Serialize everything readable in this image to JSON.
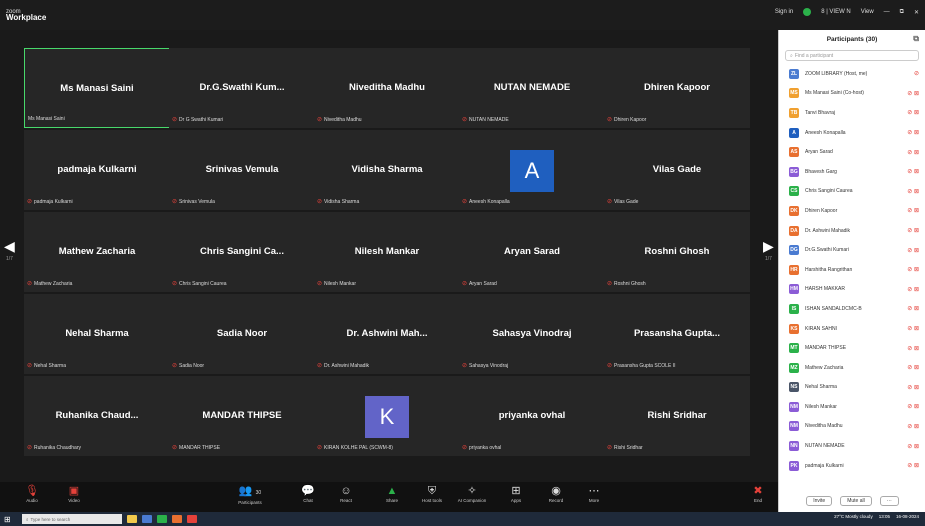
{
  "window": {
    "brand_small": "zoom",
    "app_name": "Workplace",
    "signin": "Sign in",
    "view_label": "View",
    "status_text": "8 | VIEW N"
  },
  "gallery": {
    "tiles": [
      {
        "name": "Ms Manasi Saini",
        "label": "Ms Manasi Saini"
      },
      {
        "name": "Dr.G.Swathi  Kum...",
        "label": "Dr G Swathi Kumari"
      },
      {
        "name": "Niveditha Madhu",
        "label": "Niveditha Madhu"
      },
      {
        "name": "NUTAN NEMADE",
        "label": "NUTAN NEMADE"
      },
      {
        "name": "Dhiren Kapoor",
        "label": "Dhiren Kapoor"
      },
      {
        "name": "padmaja Kulkarni",
        "label": "padmaja Kulkarni"
      },
      {
        "name": "Srinivas Vemula",
        "label": "Srinivas Vemula"
      },
      {
        "name": "Vidisha Sharma",
        "label": "Vidisha Sharma"
      },
      {
        "avatar_letter": "A",
        "label": "Aneesh Konapalla"
      },
      {
        "name": "Vilas Gade",
        "label": "Vilas Gade"
      },
      {
        "name": "Mathew Zacharia",
        "label": "Mathew Zacharia"
      },
      {
        "name": "Chris Sangini Ca...",
        "label": "Chris Sangini Caurea"
      },
      {
        "name": "Nilesh Mankar",
        "label": "Nilesh Mankar"
      },
      {
        "name": "Aryan Sarad",
        "label": "Aryan Sarad"
      },
      {
        "name": "Roshni Ghosh",
        "label": "Roshni Ghosh"
      },
      {
        "name": "Nehal Sharma",
        "label": "Nehal Sharma"
      },
      {
        "name": "Sadia Noor",
        "label": "Sadia Noor"
      },
      {
        "name": "Dr. Ashwini Mah...",
        "label": "Dr. Ashwini Mahadik"
      },
      {
        "name": "Sahasya Vinodraj",
        "label": "Sahasya Vinodraj"
      },
      {
        "name": "Prasansha Gupta...",
        "label": "Prasansha Gupta SCOLE II"
      },
      {
        "name": "Ruhanika  Chaud...",
        "label": "Ruhanika Chaudhary"
      },
      {
        "name": "MANDAR THIPSE",
        "label": "MANDAR THIPSE"
      },
      {
        "avatar_letter": "K",
        "label": "KIRAN KOLHE PAL (SCWM-8)"
      },
      {
        "name": "priyanka ovhal",
        "label": "priyanka ovhal"
      },
      {
        "name": "Rishi Sridhar",
        "label": "Rishi Sridhar"
      }
    ],
    "page_left": "1/7",
    "page_right": "1/7"
  },
  "participants": {
    "title": "Participants (30)",
    "search_placeholder": "Find a participant",
    "list": [
      {
        "initials": "ZL",
        "name": "ZOOM LIBRARY (Host, me)",
        "color": "#4a7bd1"
      },
      {
        "initials": "MS",
        "name": "Ms Manasi Saini (Co-host)",
        "color": "#f0a030"
      },
      {
        "initials": "TB",
        "name": "Tanvi Bhavraj",
        "color": "#f0a030"
      },
      {
        "initials": "A",
        "name": "Aneesh Konapalla",
        "color": "#1f5fbf"
      },
      {
        "initials": "AS",
        "name": "Aryan Sarad",
        "color": "#e87030"
      },
      {
        "initials": "BG",
        "name": "Bhavesh Garg",
        "color": "#8b5cd6"
      },
      {
        "initials": "CS",
        "name": "Chris Sangini Caurea",
        "color": "#2bb14a"
      },
      {
        "initials": "DK",
        "name": "Dhiren Kapoor",
        "color": "#e87030"
      },
      {
        "initials": "DA",
        "name": "Dr. Ashwini Mahadik",
        "color": "#e87030"
      },
      {
        "initials": "DG",
        "name": "Dr.G.Swathi Kumari",
        "color": "#4a7bd1"
      },
      {
        "initials": "HR",
        "name": "Harshitha Rangrithan",
        "color": "#e87030"
      },
      {
        "initials": "HM",
        "name": "HARSH MAKKAR",
        "color": "#8b5cd6"
      },
      {
        "initials": "IS",
        "name": "ISHAN SANDALDCMC-B",
        "color": "#2bb14a"
      },
      {
        "initials": "KS",
        "name": "KIRAN SAHNI",
        "color": "#e87030"
      },
      {
        "initials": "MT",
        "name": "MANDAR THIPSE",
        "color": "#2bb14a"
      },
      {
        "initials": "MZ",
        "name": "Mathew Zacharia",
        "color": "#2bb14a"
      },
      {
        "initials": "NS",
        "name": "Nehal Sharma",
        "color": "#4a5568"
      },
      {
        "initials": "NM",
        "name": "Nilesh Mankar",
        "color": "#8b5cd6"
      },
      {
        "initials": "NM",
        "name": "Niveditha Madhu",
        "color": "#8b5cd6"
      },
      {
        "initials": "NN",
        "name": "NUTAN NEMADE",
        "color": "#8b5cd6"
      },
      {
        "initials": "PK",
        "name": "padmaja Kulkarni",
        "color": "#8b5cd6"
      }
    ],
    "invite": "Invite",
    "mute_all": "Mute all"
  },
  "toolbar": {
    "audio": "Audio",
    "video": "Video",
    "participants": "Participants",
    "participants_count": "30",
    "chat": "Chat",
    "react": "React",
    "share": "Share",
    "host_tools": "Host tools",
    "companion": "AI Companion",
    "apps": "Apps",
    "record": "Record",
    "more": "More",
    "end": "End"
  },
  "taskbar": {
    "search": "Type here to search",
    "weather": "27°C  Mostly cloudy",
    "time": "13:05",
    "date": "16-08-2024"
  },
  "colors": {
    "accent_green": "#48d86b",
    "mute_red": "#e5413a",
    "avatar_blue": "#1f5fbf",
    "avatar_purple": "#6264c8"
  }
}
